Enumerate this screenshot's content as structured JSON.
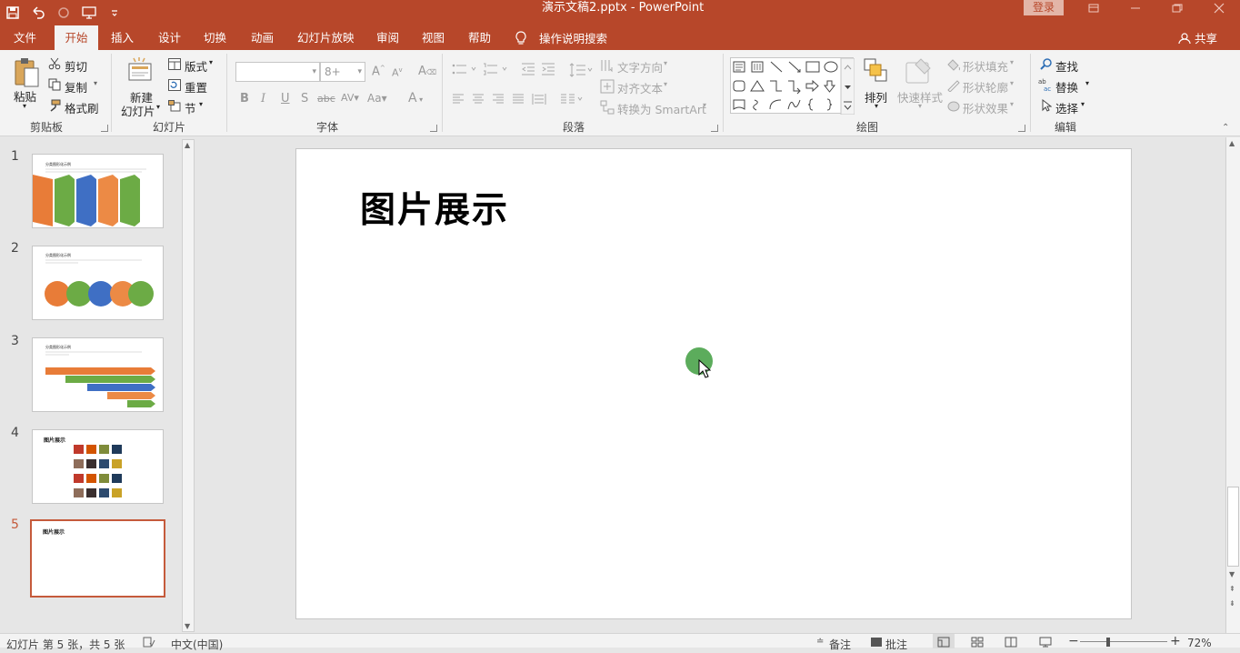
{
  "titlebar": {
    "doc_title": "演示文稿2.pptx  -  PowerPoint",
    "login": "登录"
  },
  "tabs": [
    "文件",
    "开始",
    "插入",
    "设计",
    "切换",
    "动画",
    "幻灯片放映",
    "审阅",
    "视图",
    "帮助"
  ],
  "tell_me": "操作说明搜索",
  "share": "共享",
  "ribbon": {
    "clipboard": {
      "paste": "粘贴",
      "cut": "剪切",
      "copy": "复制",
      "format_painter": "格式刷",
      "label": "剪贴板"
    },
    "slides": {
      "new_slide_1": "新建",
      "new_slide_2": "幻灯片",
      "layout": "版式",
      "reset": "重置",
      "section": "节",
      "label": "幻灯片"
    },
    "font": {
      "font_name": "",
      "font_size": "8+",
      "label": "字体"
    },
    "paragraph": {
      "text_direction": "文字方向",
      "align_text": "对齐文本",
      "smartart": "转换为 SmartArt",
      "label": "段落"
    },
    "drawing": {
      "arrange": "排列",
      "quick_styles": "快速样式",
      "shape_fill": "形状填充",
      "shape_outline": "形状轮廓",
      "shape_effects": "形状效果",
      "label": "绘图"
    },
    "editing": {
      "find": "查找",
      "replace": "替换",
      "select": "选择",
      "label": "编辑"
    }
  },
  "thumbnails": [
    {
      "num": "1",
      "title": "分类图形化示例"
    },
    {
      "num": "2",
      "title": "分类图形化示例"
    },
    {
      "num": "3",
      "title": "分类图形化示例"
    },
    {
      "num": "4",
      "title": "图片展示"
    },
    {
      "num": "5",
      "title": "图片展示"
    }
  ],
  "slide": {
    "title": "图片展示"
  },
  "statusbar": {
    "slide_info": "幻灯片 第 5 张，共 5 张",
    "language": "中文(中国)",
    "notes": "备注",
    "comments": "批注",
    "zoom": "72%"
  },
  "colors": {
    "accent": "#b7472a",
    "selected": "#c55a3b",
    "cursor": "#5cac5c"
  }
}
